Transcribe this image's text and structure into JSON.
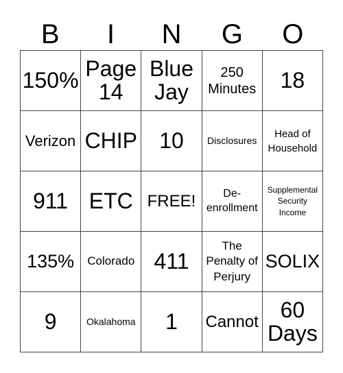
{
  "header": [
    "B",
    "I",
    "N",
    "G",
    "O"
  ],
  "cells": [
    [
      "150%",
      "Page 14",
      "Blue Jay",
      "250 Minutes",
      "18"
    ],
    [
      "Verizon",
      "CHIP",
      "10",
      "Disclosures",
      "Head of Household"
    ],
    [
      "911",
      "ETC",
      "FREE!",
      "De-enrollment",
      "Supplemental Security Income"
    ],
    [
      "135%",
      "Colorado",
      "411",
      "The Penalty of Perjury",
      "SOLIX"
    ],
    [
      "9",
      "Okalahoma",
      "1",
      "Cannot",
      "60 Days"
    ]
  ]
}
